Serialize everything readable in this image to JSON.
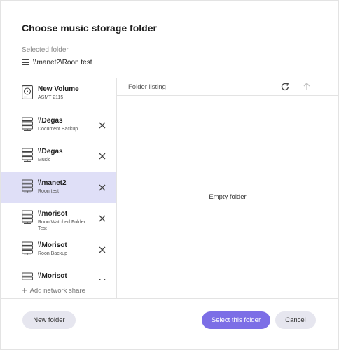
{
  "dialog": {
    "title": "Choose music storage folder",
    "selected_label": "Selected folder",
    "selected_value": "\\\\manet2\\Roon test"
  },
  "sources": [
    {
      "name": "New Volume",
      "sub": "ASMT 2115",
      "icon": "disk-icon",
      "removable": false,
      "selected": false
    },
    {
      "name": "\\\\Degas",
      "sub": "Document Backup",
      "icon": "server-icon",
      "removable": true,
      "selected": false
    },
    {
      "name": "\\\\Degas",
      "sub": "Music",
      "icon": "server-icon",
      "removable": true,
      "selected": false
    },
    {
      "name": "\\\\manet2",
      "sub": "Roon test",
      "icon": "server-icon",
      "removable": true,
      "selected": true
    },
    {
      "name": "\\\\morisot",
      "sub": "Roon Watched Folder Test",
      "icon": "server-icon",
      "removable": true,
      "selected": false
    },
    {
      "name": "\\\\Morisot",
      "sub": "Roon Backup",
      "icon": "server-icon",
      "removable": true,
      "selected": false
    },
    {
      "name": "\\\\Morisot",
      "sub": "",
      "icon": "server-icon",
      "removable": true,
      "selected": false
    }
  ],
  "sidebar": {
    "add_share_label": "Add network share"
  },
  "listing": {
    "header": "Folder listing",
    "empty_text": "Empty folder"
  },
  "buttons": {
    "new_folder": "New folder",
    "select_folder": "Select this folder",
    "cancel": "Cancel"
  },
  "colors": {
    "accent": "#7c6ee6",
    "selected_row": "#dfdff7",
    "secondary_button": "#e6e6ef"
  }
}
